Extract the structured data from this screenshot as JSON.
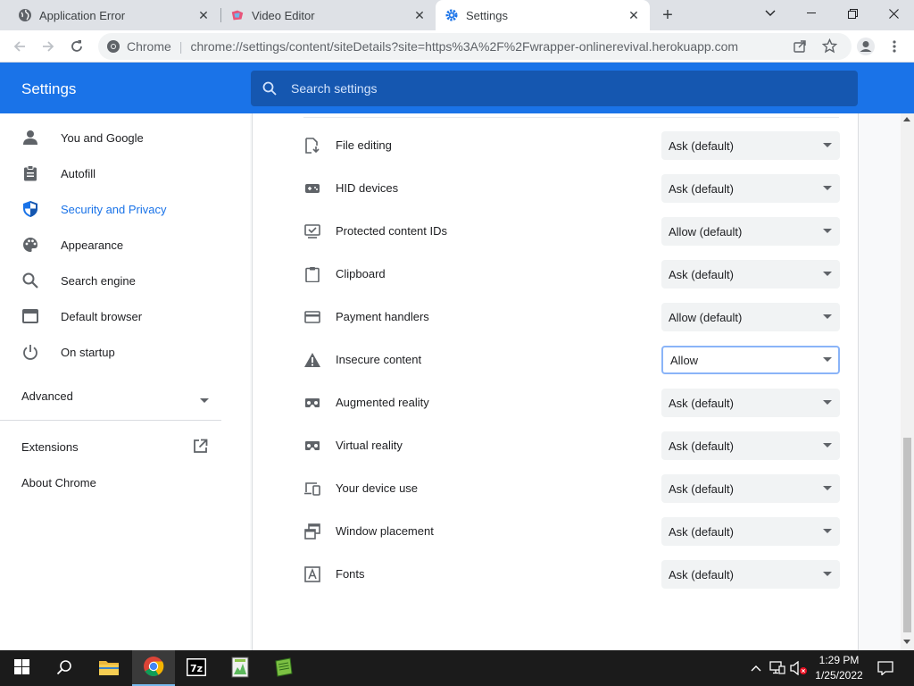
{
  "tabs": [
    {
      "title": "Application Error",
      "active": false
    },
    {
      "title": "Video Editor",
      "active": false
    },
    {
      "title": "Settings",
      "active": true
    }
  ],
  "new_tab_label": "+",
  "omnibox": {
    "site_label": "Chrome",
    "divider": "|",
    "url": "chrome://settings/content/siteDetails?site=https%3A%2F%2Fwrapper-onlinerevival.herokuapp.com"
  },
  "header": {
    "title": "Settings",
    "search_placeholder": "Search settings"
  },
  "sidebar": {
    "items": [
      {
        "label": "You and Google",
        "icon": "person-icon"
      },
      {
        "label": "Autofill",
        "icon": "clipboard-icon"
      },
      {
        "label": "Security and Privacy",
        "icon": "shield-icon",
        "active": true
      },
      {
        "label": "Appearance",
        "icon": "palette-icon"
      },
      {
        "label": "Search engine",
        "icon": "search-icon"
      },
      {
        "label": "Default browser",
        "icon": "browser-icon"
      },
      {
        "label": "On startup",
        "icon": "power-icon"
      }
    ],
    "advanced_label": "Advanced",
    "extensions_label": "Extensions",
    "about_label": "About Chrome"
  },
  "permissions": [
    {
      "label": "File editing",
      "value": "Ask (default)",
      "icon": "file-edit-icon"
    },
    {
      "label": "HID devices",
      "value": "Ask (default)",
      "icon": "gamepad-icon"
    },
    {
      "label": "Protected content IDs",
      "value": "Allow (default)",
      "icon": "protected-content-icon"
    },
    {
      "label": "Clipboard",
      "value": "Ask (default)",
      "icon": "clipboard-icon"
    },
    {
      "label": "Payment handlers",
      "value": "Allow (default)",
      "icon": "credit-card-icon"
    },
    {
      "label": "Insecure content",
      "value": "Allow",
      "icon": "warning-icon",
      "focused": true
    },
    {
      "label": "Augmented reality",
      "value": "Ask (default)",
      "icon": "vr-headset-icon"
    },
    {
      "label": "Virtual reality",
      "value": "Ask (default)",
      "icon": "vr-headset-icon"
    },
    {
      "label": "Your device use",
      "value": "Ask (default)",
      "icon": "devices-icon"
    },
    {
      "label": "Window placement",
      "value": "Ask (default)",
      "icon": "window-placement-icon"
    },
    {
      "label": "Fonts",
      "value": "Ask (default)",
      "icon": "font-icon"
    }
  ],
  "taskbar": {
    "time": "1:29 PM",
    "date": "1/25/2022"
  },
  "colors": {
    "accent": "#1a73e8",
    "search_bg": "#1557b0",
    "focus_ring": "#8ab4f8"
  }
}
